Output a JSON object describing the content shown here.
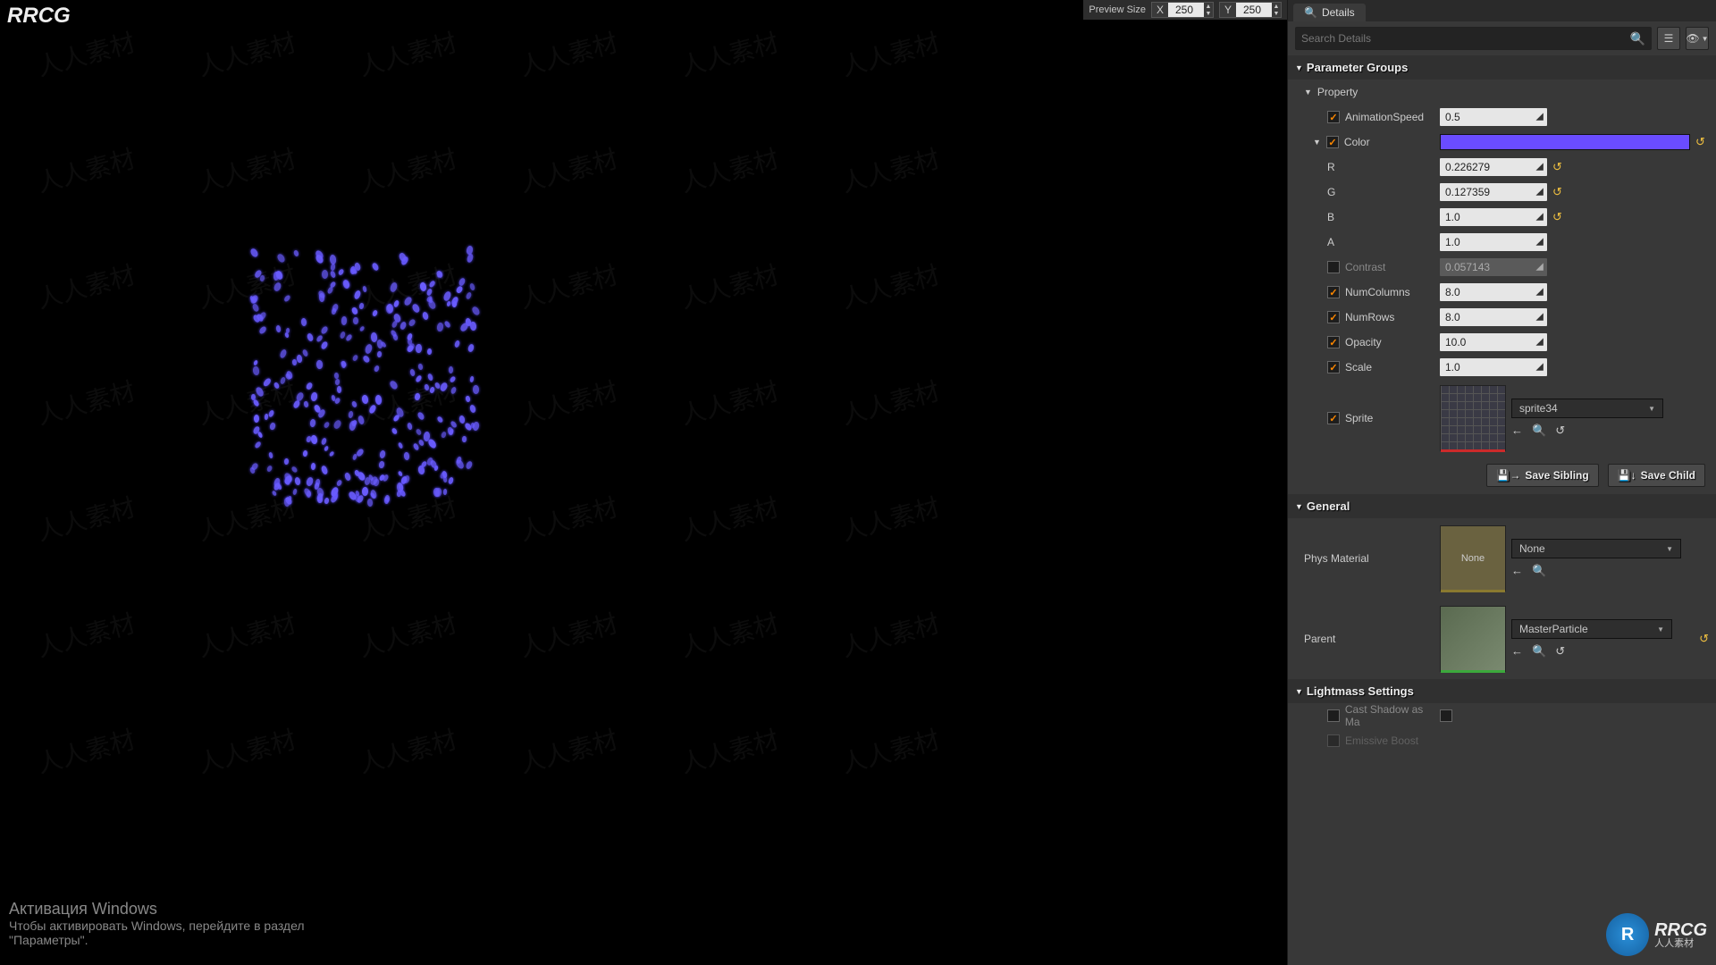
{
  "viewport": {
    "preview_label": "Preview Size",
    "x_label": "X",
    "x_value": "250",
    "y_label": "Y",
    "y_value": "250",
    "top_left_brand": "RRCG"
  },
  "tabs": {
    "details": "Details"
  },
  "search": {
    "placeholder": "Search Details"
  },
  "sections": {
    "parameter_groups": "Parameter Groups",
    "property": "Property",
    "general": "General",
    "lightmass": "Lightmass Settings"
  },
  "params": {
    "animation_speed": {
      "label": "AnimationSpeed",
      "value": "0.5"
    },
    "color": {
      "label": "Color"
    },
    "color_r": {
      "label": "R",
      "value": "0.226279"
    },
    "color_g": {
      "label": "G",
      "value": "0.127359"
    },
    "color_b": {
      "label": "B",
      "value": "1.0"
    },
    "color_a": {
      "label": "A",
      "value": "1.0"
    },
    "contrast": {
      "label": "Contrast",
      "value": "0.057143"
    },
    "num_columns": {
      "label": "NumColumns",
      "value": "8.0"
    },
    "num_rows": {
      "label": "NumRows",
      "value": "8.0"
    },
    "opacity": {
      "label": "Opacity",
      "value": "10.0"
    },
    "scale": {
      "label": "Scale",
      "value": "1.0"
    },
    "sprite": {
      "label": "Sprite",
      "select": "sprite34"
    }
  },
  "buttons": {
    "save_sibling": "Save Sibling",
    "save_child": "Save Child"
  },
  "general": {
    "phys_material": {
      "label": "Phys Material",
      "select": "None",
      "thumb_text": "None"
    },
    "parent": {
      "label": "Parent",
      "select": "MasterParticle"
    }
  },
  "lightmass": {
    "cast_shadow": "Cast Shadow as Ma",
    "emissive": "Emissive Boost"
  },
  "activation": {
    "title": "Активация Windows",
    "sub": "Чтобы активировать Windows, перейдите в раздел",
    "sub2": "\"Параметры\"."
  },
  "logo": {
    "big": "RRCG",
    "small": "人人素材"
  },
  "watermark_text": "人人素材"
}
